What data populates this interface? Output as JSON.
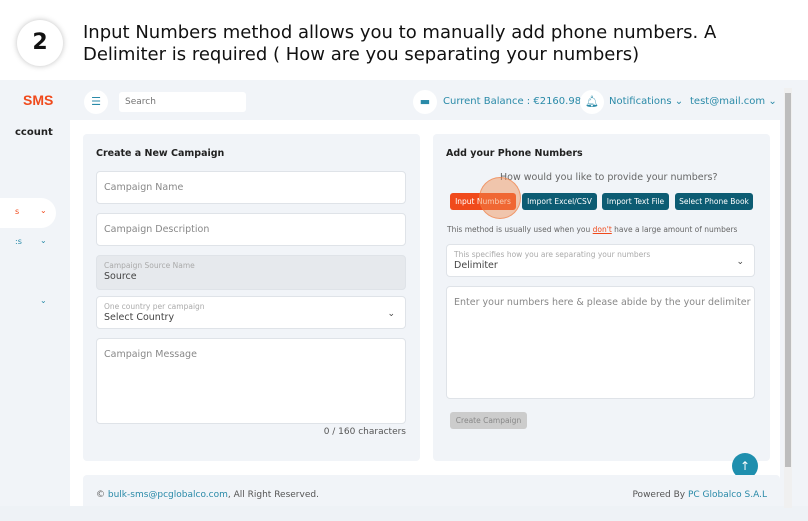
{
  "instruction": {
    "step": "2",
    "text": "Input Numbers method allows you to manually add phone numbers. A Delimiter is required ( How are you separating your numbers)"
  },
  "sidebar": {
    "logo": "SMS",
    "account": "ccount",
    "items": [
      {
        "label": "s"
      },
      {
        "label": ":s"
      },
      {
        "label": ""
      }
    ]
  },
  "header": {
    "search_placeholder": "Search",
    "balance": "Current Balance :  €2160.98",
    "notifications": "Notifications",
    "user": "test@mail.com"
  },
  "left_card": {
    "title": "Create a New Campaign",
    "name_placeholder": "Campaign Name",
    "desc_placeholder": "Campaign Description",
    "source_label": "Campaign Source Name",
    "source_value": "Source",
    "country_label": "One country per campaign",
    "country_value": "Select Country",
    "message_placeholder": "Campaign Message",
    "char_count": "0 / 160 characters"
  },
  "right_card": {
    "title": "Add your Phone Numbers",
    "question": "How would you like to provide your numbers?",
    "buttons": [
      "Input Numbers",
      "Import Excel/CSV",
      "Import Text File",
      "Select Phone Book"
    ],
    "hint_pre": "This method is usually used when you ",
    "hint_em": "don't",
    "hint_post": " have a large amount of numbers",
    "delim_label": "This specifies how you are separating your numbers",
    "delim_value": "Delimiter",
    "numbers_placeholder": "Enter your numbers here & please abide by the your delimiter",
    "create_label": "Create Campaign"
  },
  "footer": {
    "copy": "© ",
    "email": "bulk-sms@pcglobalco.com",
    "rights": ", All Right Reserved.",
    "powered": "Powered By ",
    "company": "PC Globalco S.A.L"
  },
  "colors": {
    "accent": "#f04a1c",
    "primary": "#0d5c73",
    "link": "#2a8aa8"
  }
}
